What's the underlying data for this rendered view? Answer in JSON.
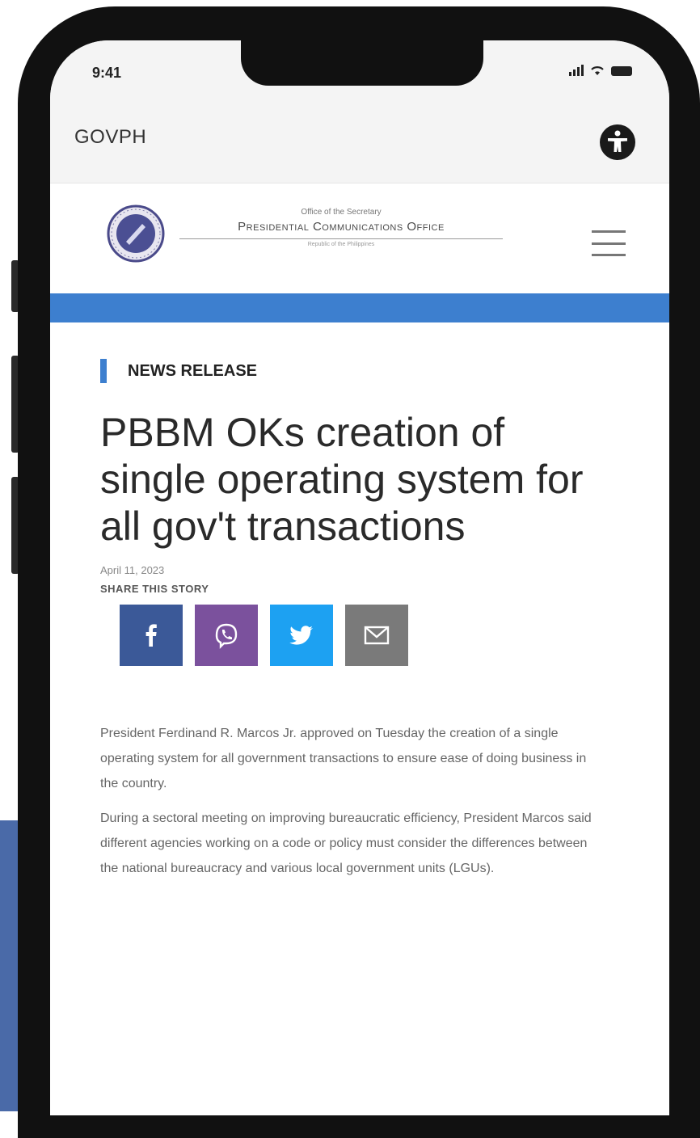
{
  "status_bar": {
    "time": "9:41"
  },
  "gov_bar": {
    "label": "GOVPH",
    "accessibility_icon": "accessibility-icon"
  },
  "site_header": {
    "office_line1": "Office of the Secretary",
    "office_name": "Presidential Communications Office",
    "office_line3": "Republic of the Philippines",
    "seal_icon": "pco-seal-icon",
    "menu_icon": "hamburger-menu-icon"
  },
  "article": {
    "category": "NEWS RELEASE",
    "headline": "PBBM OKs creation of single operating system for all gov't transactions",
    "date": "April 11, 2023",
    "share_label": "SHARE THIS STORY",
    "share_buttons": [
      {
        "name": "facebook",
        "icon": "facebook-icon",
        "color": "#3b5998"
      },
      {
        "name": "viber",
        "icon": "viber-icon",
        "color": "#7b519d"
      },
      {
        "name": "twitter",
        "icon": "twitter-icon",
        "color": "#1da1f2"
      },
      {
        "name": "email",
        "icon": "mail-icon",
        "color": "#7a7a7a"
      }
    ],
    "paragraphs": [
      "President Ferdinand R. Marcos Jr. approved on Tuesday the creation of a single operating system for all government transactions to ensure ease of doing business in the country.",
      "During a sectoral meeting on improving bureaucratic efficiency, President Marcos said different agencies working on a code or policy must consider the differences between the national bureaucracy and various local government units (LGUs)."
    ]
  },
  "colors": {
    "accent_blue": "#3d7fcf",
    "facebook": "#3b5998",
    "viber": "#7b519d",
    "twitter": "#1da1f2",
    "email": "#7a7a7a"
  }
}
